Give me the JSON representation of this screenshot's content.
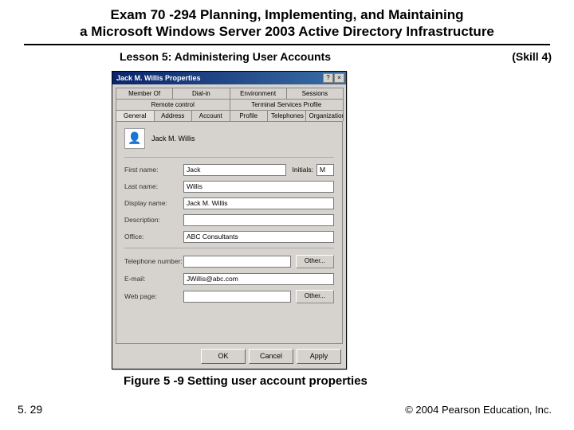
{
  "header": {
    "title_line1": "Exam 70 -294 Planning, Implementing, and Maintaining",
    "title_line2": "a Microsoft Windows Server 2003 Active Directory Infrastructure",
    "lesson": "Lesson 5: Administering User Accounts",
    "skill": "(Skill 4)"
  },
  "dialog": {
    "title": "Jack M. Willis Properties",
    "help_label": "?",
    "close_label": "×",
    "tabs_row1": [
      "Member Of",
      "Dial-in",
      "Environment",
      "Sessions"
    ],
    "tabs_row2": [
      "Remote control",
      "Terminal Services Profile"
    ],
    "tabs_row3": [
      "General",
      "Address",
      "Account",
      "Profile",
      "Telephones",
      "Organization"
    ],
    "active_tab": "General",
    "identity_name": "Jack M. Willis",
    "fields": {
      "first_name_label": "First name:",
      "first_name_value": "Jack",
      "initials_label": "Initials:",
      "initials_value": "M",
      "last_name_label": "Last name:",
      "last_name_value": "Willis",
      "display_name_label": "Display name:",
      "display_name_value": "Jack M. Willis",
      "description_label": "Description:",
      "description_value": "",
      "office_label": "Office:",
      "office_value": "ABC Consultants",
      "telephone_label": "Telephone number:",
      "telephone_value": "",
      "email_label": "E-mail:",
      "email_value": "JWillis@abc.com",
      "webpage_label": "Web page:",
      "webpage_value": "",
      "other_btn": "Other..."
    },
    "buttons": {
      "ok": "OK",
      "cancel": "Cancel",
      "apply": "Apply"
    }
  },
  "caption": "Figure 5 -9 Setting user account properties",
  "footer": {
    "page": "5. 29",
    "copyright": "© 2004 Pearson Education, Inc."
  }
}
